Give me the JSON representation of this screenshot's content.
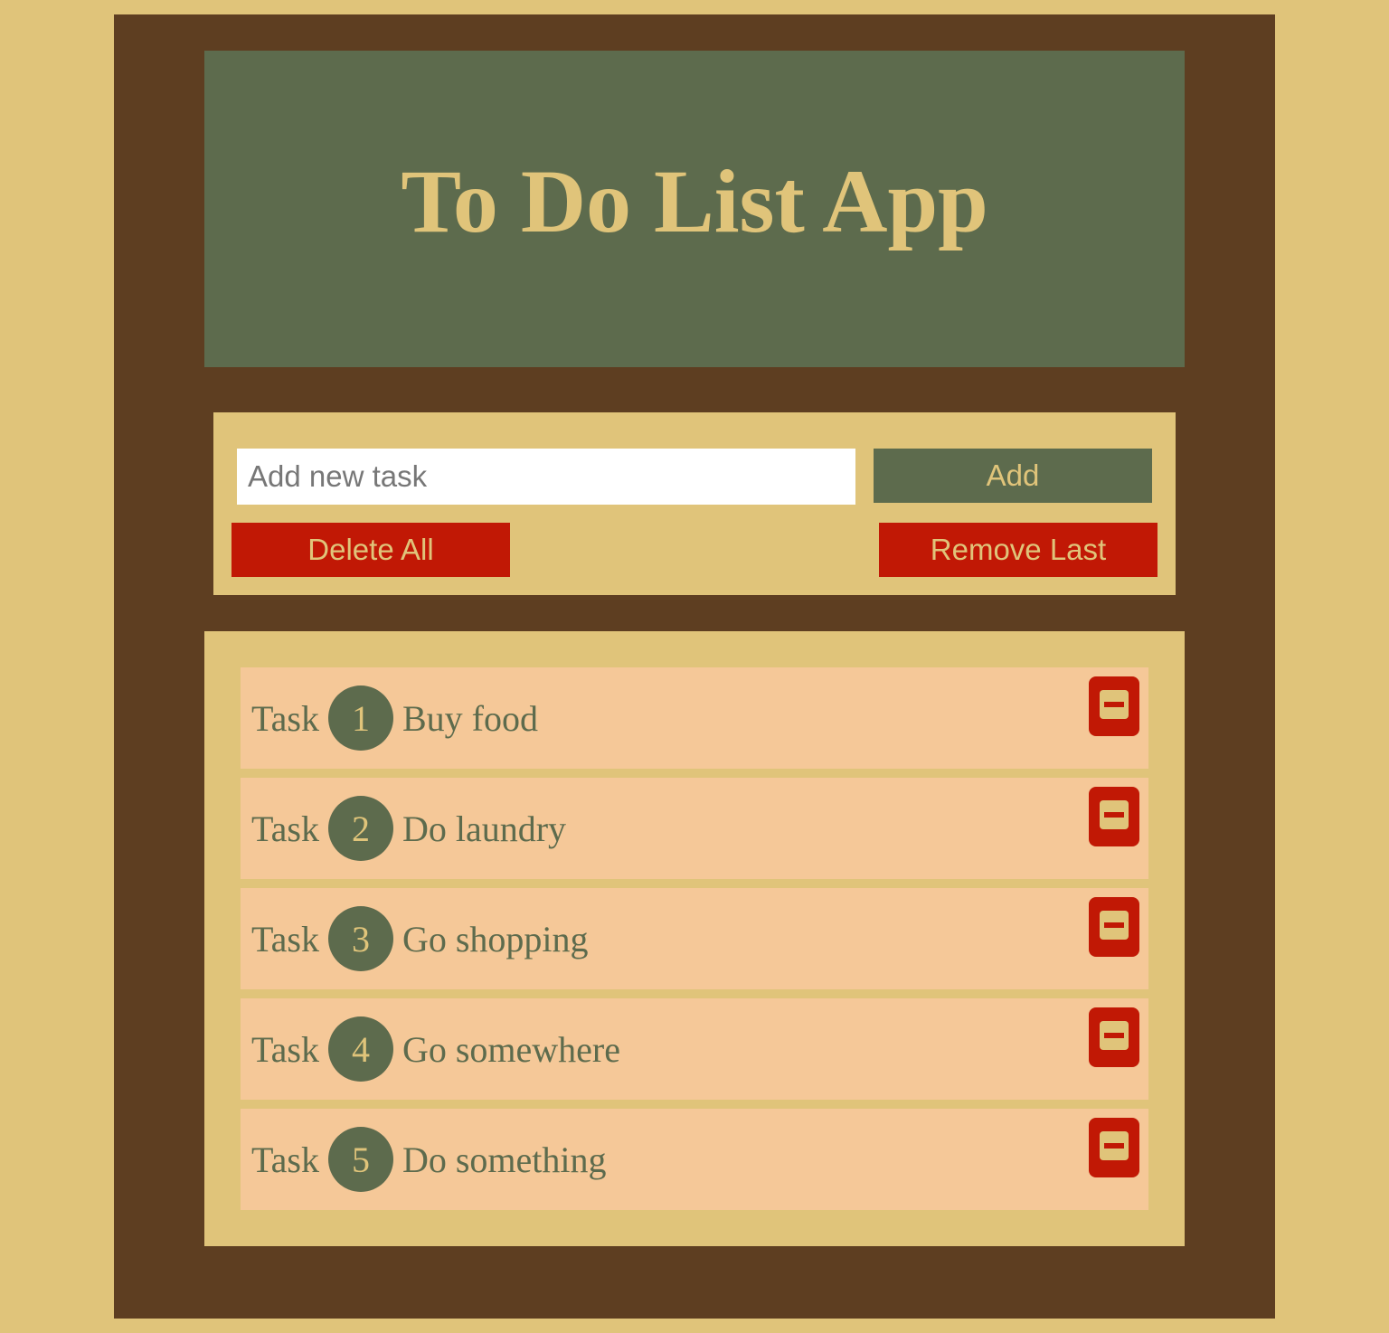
{
  "app": {
    "title": "To Do List App"
  },
  "controls": {
    "input_placeholder": "Add new task",
    "input_value": "",
    "add_label": "Add",
    "delete_all_label": "Delete All",
    "remove_last_label": "Remove Last"
  },
  "tasks": {
    "prefix": "Task",
    "items": [
      {
        "number": "1",
        "text": "Buy food"
      },
      {
        "number": "2",
        "text": "Do laundry"
      },
      {
        "number": "3",
        "text": "Go shopping"
      },
      {
        "number": "4",
        "text": "Go somewhere"
      },
      {
        "number": "5",
        "text": "Do something"
      }
    ],
    "remove_icon": "minus-square-icon"
  },
  "colors": {
    "background": "#e0c47a",
    "frame": "#5e3e21",
    "header": "#5d6b4d",
    "accent_red": "#c11805",
    "task_bg": "#f5c898",
    "text_green": "#5d6b4d",
    "text_gold": "#e0c47a"
  }
}
